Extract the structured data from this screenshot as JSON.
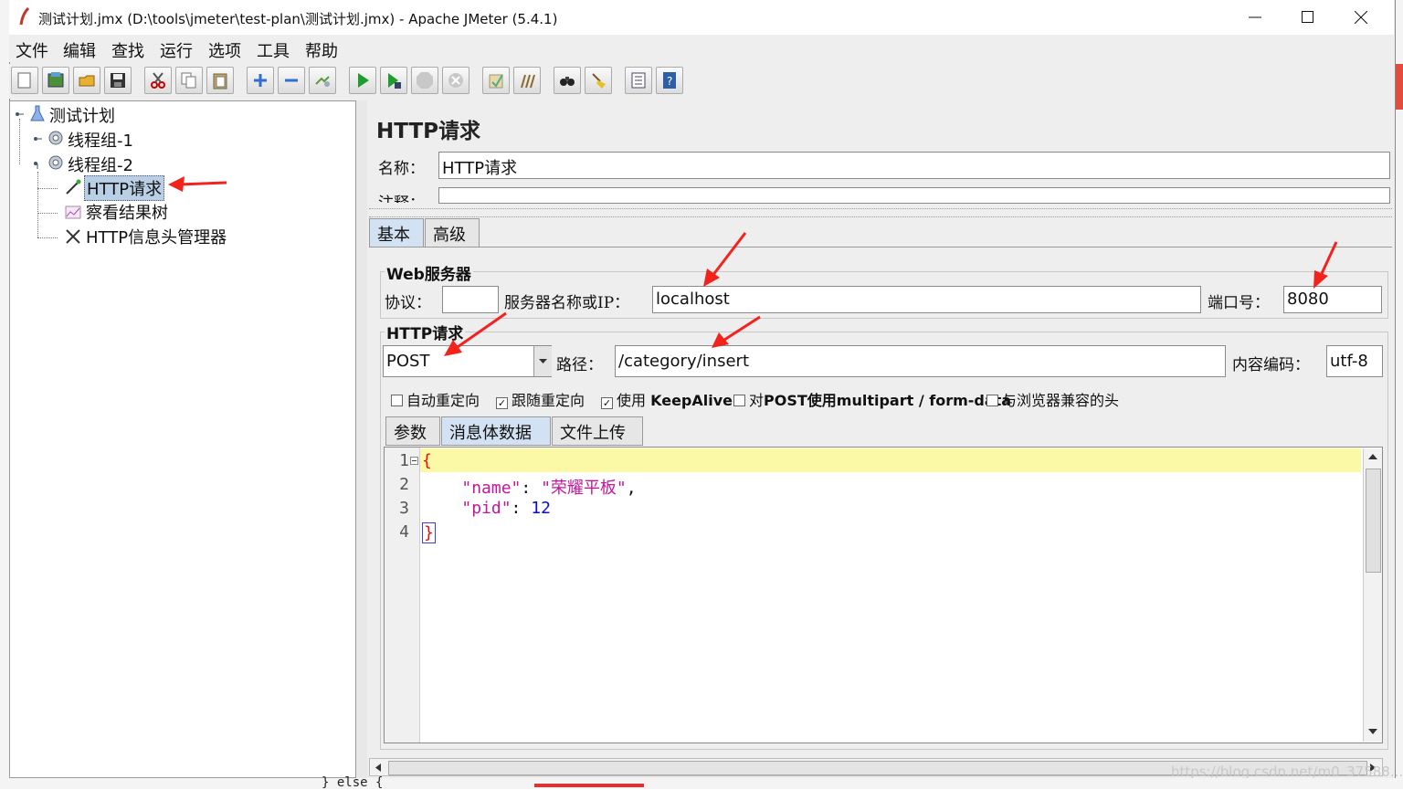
{
  "window": {
    "title": "测试计划.jmx (D:\\tools\\jmeter\\test-plan\\测试计划.jmx) - Apache JMeter (5.4.1)"
  },
  "menu": [
    "文件",
    "编辑",
    "查找",
    "运行",
    "选项",
    "工具",
    "帮助"
  ],
  "toolbar": {
    "icons": [
      "new-icon",
      "templates-icon",
      "open-icon",
      "save-icon",
      "cut-icon",
      "copy-icon",
      "paste-icon",
      "expand-icon",
      "collapse-icon",
      "toggle-icon",
      "start-icon",
      "start-no-pause-icon",
      "stop-icon",
      "shutdown-icon",
      "clear-icon",
      "clear-all-icon",
      "search-icon",
      "reset-search-icon",
      "function-helper-icon",
      "help-icon"
    ]
  },
  "tree": {
    "items": [
      {
        "label": "测试计划"
      },
      {
        "label": "线程组-1"
      },
      {
        "label": "线程组-2"
      },
      {
        "label": "HTTP请求"
      },
      {
        "label": "察看结果树"
      },
      {
        "label": "HTTP信息头管理器"
      }
    ]
  },
  "panel": {
    "title": "HTTP请求",
    "name_label": "名称：",
    "name_value": "HTTP请求",
    "comment_label": "注释：",
    "tabs": [
      "基本",
      "高级"
    ],
    "web_server": {
      "legend": "Web服务器",
      "protocol_label": "协议：",
      "protocol_value": "",
      "server_label": "服务器名称或IP：",
      "server_value": "localhost",
      "port_label": "端口号：",
      "port_value": "8080"
    },
    "http_request": {
      "legend": "HTTP请求",
      "method": "POST",
      "path_label": "路径：",
      "path_value": "/category/insert",
      "encoding_label": "内容编码：",
      "encoding_value": "utf-8"
    },
    "checkboxes": [
      {
        "label": "自动重定向",
        "checked": false
      },
      {
        "label": "跟随重定向",
        "checked": true
      },
      {
        "label_prefix": "使用 ",
        "label_bold": "KeepAlive",
        "checked": true
      },
      {
        "label_prefix": "对",
        "label_bold": "POST使用multipart / form-data",
        "checked": false
      },
      {
        "label": "与浏览器兼容的头",
        "checked": false
      }
    ],
    "subtabs": [
      "参数",
      "消息体数据",
      "文件上传"
    ],
    "body": {
      "line_numbers": [
        "1",
        "2",
        "3",
        "4"
      ],
      "l1": "{",
      "l2_key": "\"name\"",
      "l2_sep": ": ",
      "l2_val": "\"荣耀平板\"",
      "l2_end": ",",
      "l3_key": "\"pid\"",
      "l3_sep": ": ",
      "l3_val": "12",
      "l4": "}"
    }
  },
  "watermark": "https://blog.csdn.net/m0_37588...",
  "bottom_text": "} else {"
}
